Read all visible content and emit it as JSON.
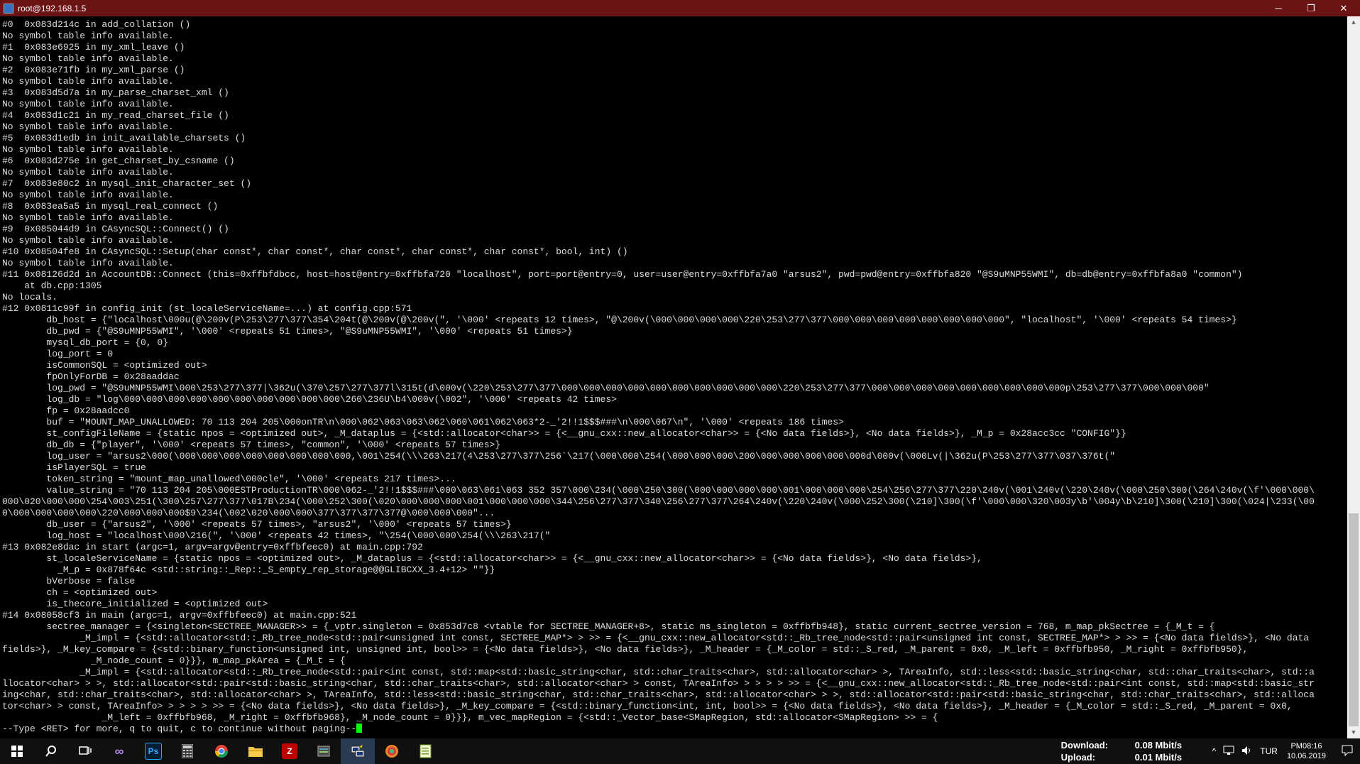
{
  "window": {
    "title": "root@192.168.1.5",
    "minimize_label": "─",
    "restore_label": "❐",
    "close_label": "✕"
  },
  "terminal": {
    "text": "#0  0x083d214c in add_collation ()\nNo symbol table info available.\n#1  0x083e6925 in my_xml_leave ()\nNo symbol table info available.\n#2  0x083e71fb in my_xml_parse ()\nNo symbol table info available.\n#3  0x083d5d7a in my_parse_charset_xml ()\nNo symbol table info available.\n#4  0x083d1c21 in my_read_charset_file ()\nNo symbol table info available.\n#5  0x083d1edb in init_available_charsets ()\nNo symbol table info available.\n#6  0x083d275e in get_charset_by_csname ()\nNo symbol table info available.\n#7  0x083e80c2 in mysql_init_character_set ()\nNo symbol table info available.\n#8  0x083ea5a5 in mysql_real_connect ()\nNo symbol table info available.\n#9  0x085044d9 in CAsyncSQL::Connect() ()\nNo symbol table info available.\n#10 0x08504fe8 in CAsyncSQL::Setup(char const*, char const*, char const*, char const*, char const*, bool, int) ()\nNo symbol table info available.\n#11 0x08126d2d in AccountDB::Connect (this=0xffbfdbcc, host=host@entry=0xffbfa720 \"localhost\", port=port@entry=0, user=user@entry=0xffbfa7a0 \"arsus2\", pwd=pwd@entry=0xffbfa820 \"@S9uMNP55WMI\", db=db@entry=0xffbfa8a0 \"common\")\n    at db.cpp:1305\nNo locals.\n#12 0x0811c99f in config_init (st_localeServiceName=...) at config.cpp:571\n        db_host = {\"localhost\\000u(@\\200v(P\\253\\277\\377\\354\\204t(@\\200v(@\\200v(\", '\\000' <repeats 12 times>, \"@\\200v(\\000\\000\\000\\000\\220\\253\\277\\377\\000\\000\\000\\000\\000\\000\\000\\000\", \"localhost\", '\\000' <repeats 54 times>}\n        db_pwd = {\"@S9uMNP55WMI\", '\\000' <repeats 51 times>, \"@S9uMNP55WMI\", '\\000' <repeats 51 times>}\n        mysql_db_port = {0, 0}\n        log_port = 0\n        isCommonSQL = <optimized out>\n        fpOnlyForDB = 0x28aaddac\n        log_pwd = \"@S9uMNP55WMI\\000\\253\\277\\377|\\362u(\\370\\257\\277\\377l\\315t(d\\000v(\\220\\253\\277\\377\\000\\000\\000\\000\\000\\000\\000\\000\\000\\000\\220\\253\\277\\377\\000\\000\\000\\000\\000\\000\\000\\000\\000p\\253\\277\\377\\000\\000\\000\"\n        log_db = \"log\\000\\000\\000\\000\\000\\000\\000\\000\\000\\000\\260\\236U\\b4\\000v(\\002\", '\\000' <repeats 42 times>\n        fp = 0x28aadcc0\n        buf = \"MOUNT_MAP_UNALLOWED: 70 113 204 205\\000onTR\\n\\000\\062\\063\\063\\062\\060\\061\\062\\063*2-_'2!!1$$$###\\n\\000\\067\\n\", '\\000' <repeats 186 times>\n        st_configFileName = {static npos = <optimized out>, _M_dataplus = {<std::allocator<char>> = {<__gnu_cxx::new_allocator<char>> = {<No data fields>}, <No data fields>}, _M_p = 0x28acc3cc \"CONFIG\"}}\n        db_db = {\"player\", '\\000' <repeats 57 times>, \"common\", '\\000' <repeats 57 times>}\n        log_user = \"arsus2\\000(\\000\\000\\000\\000\\000\\000\\000\\000,\\001\\254(\\\\\\263\\217(4\\253\\277\\377\\256`\\217(\\000\\000\\254(\\000\\000\\000\\200\\000\\000\\000\\000\\000d\\000v(\\000Lv(|\\362u(P\\253\\277\\377\\037\\376t(\"\n        isPlayerSQL = true\n        token_string = \"mount_map_unallowed\\000cle\", '\\000' <repeats 217 times>...\n        value_string = \"70 113 204 205\\000ESTProductionTR\\000\\062-_'2!!1$$$###\\000\\063\\061\\063 352 357\\000\\234(\\000\\250\\300(\\000\\000\\000\\000\\001\\000\\000\\000\\254\\256\\277\\377\\220\\240v(\\001\\240v(\\220\\240v(\\000\\250\\300(\\264\\240v(\\f'\\000\\000\\\n000\\020\\000\\000\\254\\003\\251(\\300\\257\\277\\377\\017B\\234(\\000\\252\\300(\\020\\000\\000\\000\\001\\000\\000\\000\\344\\256\\277\\377\\340\\256\\277\\377\\264\\240v(\\220\\240v(\\000\\252\\300(\\210]\\300(\\f'\\000\\000\\320\\003y\\b'\\004y\\b\\210]\\300(\\210]\\300(\\024|\\233(\\00\n0\\000\\000\\000\\000\\220\\000\\000\\000$9\\234(\\002\\020\\000\\000\\377\\377\\377\\377@\\000\\000\\000\"...\n        db_user = {\"arsus2\", '\\000' <repeats 57 times>, \"arsus2\", '\\000' <repeats 57 times>}\n        log_host = \"localhost\\000\\216(\", '\\000' <repeats 42 times>, \"\\254(\\000\\000\\254(\\\\\\263\\217(\"\n#13 0x082e8dac in start (argc=1, argv=argv@entry=0xffbfeec0) at main.cpp:792\n        st_localeServiceName = {static npos = <optimized out>, _M_dataplus = {<std::allocator<char>> = {<__gnu_cxx::new_allocator<char>> = {<No data fields>}, <No data fields>},\n          _M_p = 0x878f64c <std::string::_Rep::_S_empty_rep_storage@@GLIBCXX_3.4+12> \"\"}}\n        bVerbose = false\n        ch = <optimized out>\n        is_thecore_initialized = <optimized out>\n#14 0x08058cf3 in main (argc=1, argv=0xffbfeec0) at main.cpp:521\n        sectree_manager = {<singleton<SECTREE_MANAGER>> = {_vptr.singleton = 0x853d7c8 <vtable for SECTREE_MANAGER+8>, static ms_singleton = 0xffbfb948}, static current_sectree_version = 768, m_map_pkSectree = {_M_t = {\n              _M_impl = {<std::allocator<std::_Rb_tree_node<std::pair<unsigned int const, SECTREE_MAP*> > >> = {<__gnu_cxx::new_allocator<std::_Rb_tree_node<std::pair<unsigned int const, SECTREE_MAP*> > >> = {<No data fields>}, <No data\nfields>}, _M_key_compare = {<std::binary_function<unsigned int, unsigned int, bool>> = {<No data fields>}, <No data fields>}, _M_header = {_M_color = std::_S_red, _M_parent = 0x0, _M_left = 0xffbfb950, _M_right = 0xffbfb950},\n                _M_node_count = 0}}}, m_map_pkArea = {_M_t = {\n              _M_impl = {<std::allocator<std::_Rb_tree_node<std::pair<int const, std::map<std::basic_string<char, std::char_traits<char>, std::allocator<char> >, TAreaInfo, std::less<std::basic_string<char, std::char_traits<char>, std::a\nllocator<char> > >, std::allocator<std::pair<std::basic_string<char, std::char_traits<char>, std::allocator<char> > const, TAreaInfo> > > > > >> = {<__gnu_cxx::new_allocator<std::_Rb_tree_node<std::pair<int const, std::map<std::basic_str\ning<char, std::char_traits<char>, std::allocator<char> >, TAreaInfo, std::less<std::basic_string<char, std::char_traits<char>, std::allocator<char> > >, std::allocator<std::pair<std::basic_string<char, std::char_traits<char>, std::alloca\ntor<char> > const, TAreaInfo> > > > > >> = {<No data fields>}, <No data fields>}, _M_key_compare = {<std::binary_function<int, int, bool>> = {<No data fields>}, <No data fields>}, _M_header = {_M_color = std::_S_red, _M_parent = 0x0,\n                  _M_left = 0xffbfb968, _M_right = 0xffbfb968}, _M_node_count = 0}}}, m_vec_mapRegion = {<std::_Vector_base<SMapRegion, std::allocator<SMapRegion> >> = {",
    "prompt": "--Type <RET> for more, q to quit, c to continue without paging--"
  },
  "taskbar": {
    "net_download_label": "Download:",
    "net_download_value": "0.08 Mbit/s",
    "net_upload_label": "Upload:",
    "net_upload_value": "0.01 Mbit/s",
    "language": "TUR",
    "time": "PM08:16",
    "date": "10.06.2019",
    "apps": [
      {
        "icon": "windows-start-icon"
      },
      {
        "icon": "search-icon"
      },
      {
        "icon": "task-view-icon"
      },
      {
        "icon": "visual-studio-icon"
      },
      {
        "icon": "photoshop-icon",
        "text": "Ps"
      },
      {
        "icon": "calculator-icon"
      },
      {
        "icon": "chrome-icon"
      },
      {
        "icon": "file-explorer-icon"
      },
      {
        "icon": "filezilla-icon"
      },
      {
        "icon": "app-icon"
      },
      {
        "icon": "putty-icon",
        "active": true
      },
      {
        "icon": "colorful-app-icon"
      },
      {
        "icon": "notepad-plus-plus-icon"
      }
    ]
  },
  "colors": {
    "titlebar": "#6b1414",
    "terminal_bg": "#000000",
    "terminal_fg": "#dddddd",
    "cursor": "#00ff00",
    "taskbar": "#101010"
  }
}
